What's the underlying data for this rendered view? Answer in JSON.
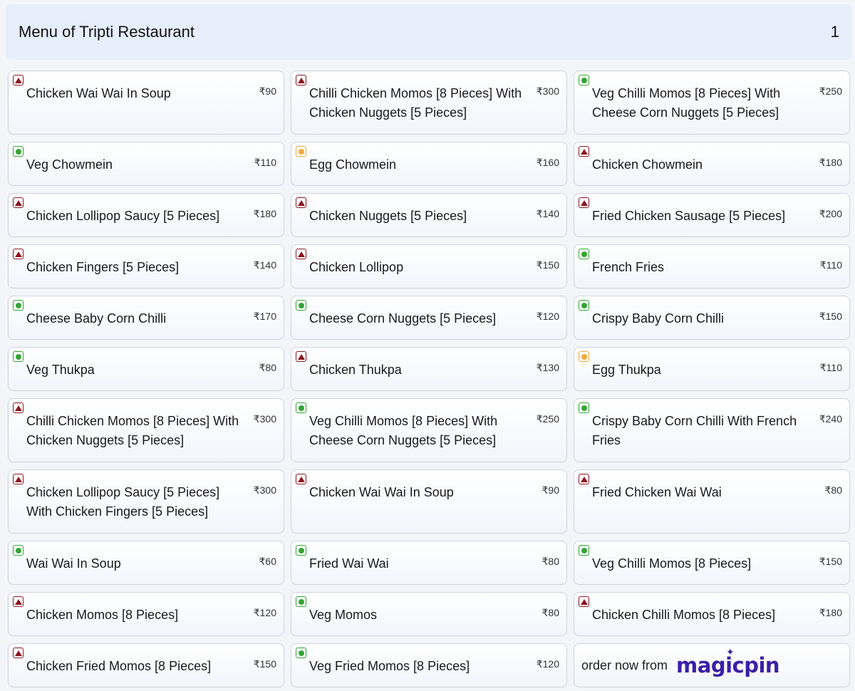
{
  "header": {
    "title": "Menu of Tripti Restaurant",
    "page": "1"
  },
  "rows": [
    {
      "size": "r1",
      "items": [
        {
          "type": "nonveg",
          "name": "Chicken Wai Wai In Soup",
          "price": "₹90"
        },
        {
          "type": "nonveg",
          "name": "Chilli Chicken Momos [8 Pieces] With Chicken Nuggets [5 Pieces]",
          "price": "₹300"
        },
        {
          "type": "veg",
          "name": "Veg Chilli Momos [8 Pieces] With Cheese Corn Nuggets [5 Pieces]",
          "price": "₹250"
        }
      ]
    },
    {
      "size": "r2",
      "items": [
        {
          "type": "veg",
          "name": "Veg Chowmein",
          "price": "₹110"
        },
        {
          "type": "egg",
          "name": "Egg Chowmein",
          "price": "₹160"
        },
        {
          "type": "nonveg",
          "name": "Chicken Chowmein",
          "price": "₹180"
        }
      ]
    },
    {
      "size": "r2",
      "items": [
        {
          "type": "nonveg",
          "name": "Chicken Lollipop Saucy [5 Pieces]",
          "price": "₹180"
        },
        {
          "type": "nonveg",
          "name": "Chicken Nuggets [5 Pieces]",
          "price": "₹140"
        },
        {
          "type": "nonveg",
          "name": "Fried Chicken Sausage [5 Pieces]",
          "price": "₹200"
        }
      ]
    },
    {
      "size": "r2",
      "items": [
        {
          "type": "nonveg",
          "name": "Chicken Fingers [5 Pieces]",
          "price": "₹140"
        },
        {
          "type": "nonveg",
          "name": "Chicken Lollipop",
          "price": "₹150"
        },
        {
          "type": "veg",
          "name": "French Fries",
          "price": "₹110"
        }
      ]
    },
    {
      "size": "r2",
      "items": [
        {
          "type": "veg",
          "name": "Cheese Baby Corn Chilli",
          "price": "₹170"
        },
        {
          "type": "veg",
          "name": "Cheese Corn Nuggets [5 Pieces]",
          "price": "₹120"
        },
        {
          "type": "veg",
          "name": "Crispy Baby Corn Chilli",
          "price": "₹150"
        }
      ]
    },
    {
      "size": "r2",
      "items": [
        {
          "type": "veg",
          "name": "Veg Thukpa",
          "price": "₹80"
        },
        {
          "type": "nonveg",
          "name": "Chicken Thukpa",
          "price": "₹130"
        },
        {
          "type": "egg",
          "name": "Egg Thukpa",
          "price": "₹110"
        }
      ]
    },
    {
      "size": "r1",
      "items": [
        {
          "type": "nonveg",
          "name": "Chilli Chicken Momos [8 Pieces] With Chicken Nuggets [5 Pieces]",
          "price": "₹300"
        },
        {
          "type": "veg",
          "name": "Veg Chilli Momos [8 Pieces] With Cheese Corn Nuggets [5 Pieces]",
          "price": "₹250"
        },
        {
          "type": "veg",
          "name": "Crispy Baby Corn Chilli With French Fries",
          "price": "₹240"
        }
      ]
    },
    {
      "size": "r1",
      "items": [
        {
          "type": "nonveg",
          "name": "Chicken Lollipop Saucy [5 Pieces] With Chicken Fingers [5 Pieces]",
          "price": "₹300"
        },
        {
          "type": "nonveg",
          "name": "Chicken Wai Wai In Soup",
          "price": "₹90"
        },
        {
          "type": "nonveg",
          "name": "Fried Chicken Wai Wai",
          "price": "₹80"
        }
      ]
    },
    {
      "size": "r2",
      "items": [
        {
          "type": "veg",
          "name": "Wai Wai In Soup",
          "price": "₹60"
        },
        {
          "type": "veg",
          "name": "Fried Wai Wai",
          "price": "₹80"
        },
        {
          "type": "veg",
          "name": "Veg Chilli Momos [8 Pieces]",
          "price": "₹150"
        }
      ]
    },
    {
      "size": "r2",
      "items": [
        {
          "type": "nonveg",
          "name": "Chicken Momos [8 Pieces]",
          "price": "₹120"
        },
        {
          "type": "veg",
          "name": "Veg Momos",
          "price": "₹80"
        },
        {
          "type": "nonveg",
          "name": "Chicken Chilli Momos [8 Pieces]",
          "price": "₹180"
        }
      ]
    },
    {
      "size": "r2",
      "items": [
        {
          "type": "nonveg",
          "name": "Chicken Fried Momos [8 Pieces]",
          "price": "₹150"
        },
        {
          "type": "veg",
          "name": "Veg Fried Momos [8 Pieces]",
          "price": "₹120"
        },
        {
          "promo": true
        }
      ]
    }
  ],
  "promo": {
    "text": "order now from",
    "logo": "magicpin",
    "logo_star": "✦"
  }
}
